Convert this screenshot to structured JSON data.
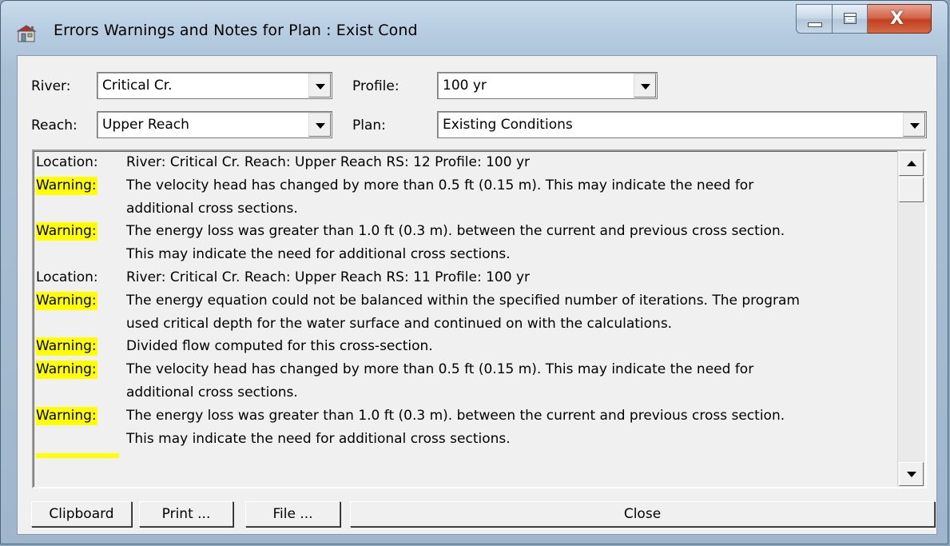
{
  "window": {
    "title": "Errors Warnings and Notes for Plan : Exist Cond",
    "close_glyph": "X"
  },
  "filters": {
    "river_label": "River:",
    "river_value": "Critical Cr.",
    "reach_label": "Reach:",
    "reach_value": "Upper Reach",
    "profile_label": "Profile:",
    "profile_value": "100 yr",
    "plan_label": "Plan:",
    "plan_value": "Existing Conditions"
  },
  "messages": [
    {
      "tag": "Location:",
      "kind": "location",
      "text": "River: Critical Cr.  Reach: Upper Reach     RS: 12     Profile: 100 yr"
    },
    {
      "tag": "Warning:",
      "kind": "warning",
      "text": "The velocity head has changed by more than 0.5 ft (0.15 m).  This may indicate the need for"
    },
    {
      "tag": "",
      "kind": "cont",
      "text": "additional cross sections."
    },
    {
      "tag": "Warning:",
      "kind": "warning",
      "text": "The energy loss was greater than 1.0 ft (0.3 m). between the current and previous cross section."
    },
    {
      "tag": "",
      "kind": "cont",
      "text": "This may indicate the need for additional cross sections."
    },
    {
      "tag": "Location:",
      "kind": "location",
      "text": "River: Critical Cr.  Reach: Upper Reach     RS: 11     Profile: 100 yr"
    },
    {
      "tag": "Warning:",
      "kind": "warning",
      "text": "The energy equation could not be balanced within the specified number of iterations.  The program"
    },
    {
      "tag": "",
      "kind": "cont",
      "text": "used critical depth for the water surface and continued on with the calculations."
    },
    {
      "tag": "Warning:",
      "kind": "warning",
      "text": "Divided flow computed for this cross-section."
    },
    {
      "tag": "Warning:",
      "kind": "warning",
      "text": "The velocity head has changed by more than 0.5 ft (0.15 m).  This may indicate the need for"
    },
    {
      "tag": "",
      "kind": "cont",
      "text": "additional cross sections."
    },
    {
      "tag": "Warning:",
      "kind": "warning",
      "text": "The energy loss was greater than 1.0 ft (0.3 m). between the current and previous cross section."
    },
    {
      "tag": "",
      "kind": "cont",
      "text": "This may indicate the need for additional cross sections."
    }
  ],
  "buttons": {
    "clipboard": "Clipboard",
    "print": "Print ...",
    "file": "File ...",
    "close": "Close"
  },
  "colors": {
    "warning_highlight": "#ffff00",
    "client_bg": "#f0f0f0",
    "close_button": "#c2401f"
  }
}
